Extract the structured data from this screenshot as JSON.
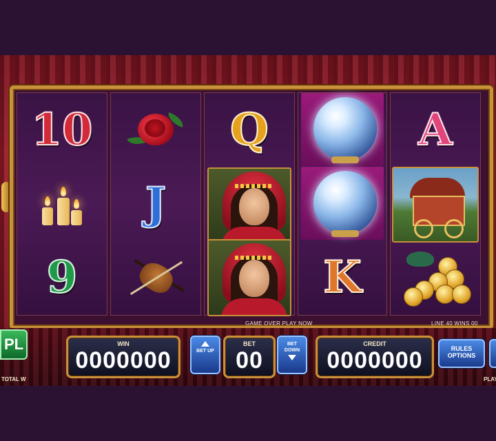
{
  "status": {
    "left_message": "GAME OVER PLAY NOW",
    "right_message": "LINE 40 WINS 00"
  },
  "reels": {
    "reel1": [
      "10",
      "candles",
      "9"
    ],
    "reel2": [
      "rose",
      "J",
      "violin"
    ],
    "reel3": [
      "Q",
      "fortune-teller",
      "fortune-teller"
    ],
    "reel4": [
      "crystal-ball",
      "crystal-ball",
      "K"
    ],
    "reel5": [
      "A",
      "wagon",
      "gold-coins"
    ]
  },
  "symbols": {
    "ten": "10",
    "nine": "9",
    "jack": "J",
    "queen": "Q",
    "king": "K",
    "ace": "A"
  },
  "controls": {
    "play_label": "PL",
    "total_win_label": "TOTAL W",
    "win_label": "WIN",
    "win_value": "0000000",
    "bet_up_label": "BET UP",
    "bet_label": "BET",
    "bet_value": "00",
    "bet_down_label": "BET DOWN",
    "credit_label": "CREDIT",
    "credit_value": "0000000",
    "rules_label": "RULES",
    "options_label": "OPTIONS",
    "right_edge_label": "PLAY"
  },
  "colors": {
    "frame_gold": "#c9913a",
    "curtain_red": "#9c1c2a",
    "reel_purple": "#4b1a55",
    "button_blue": "#2f6fd6",
    "button_green": "#1f9a4a"
  }
}
